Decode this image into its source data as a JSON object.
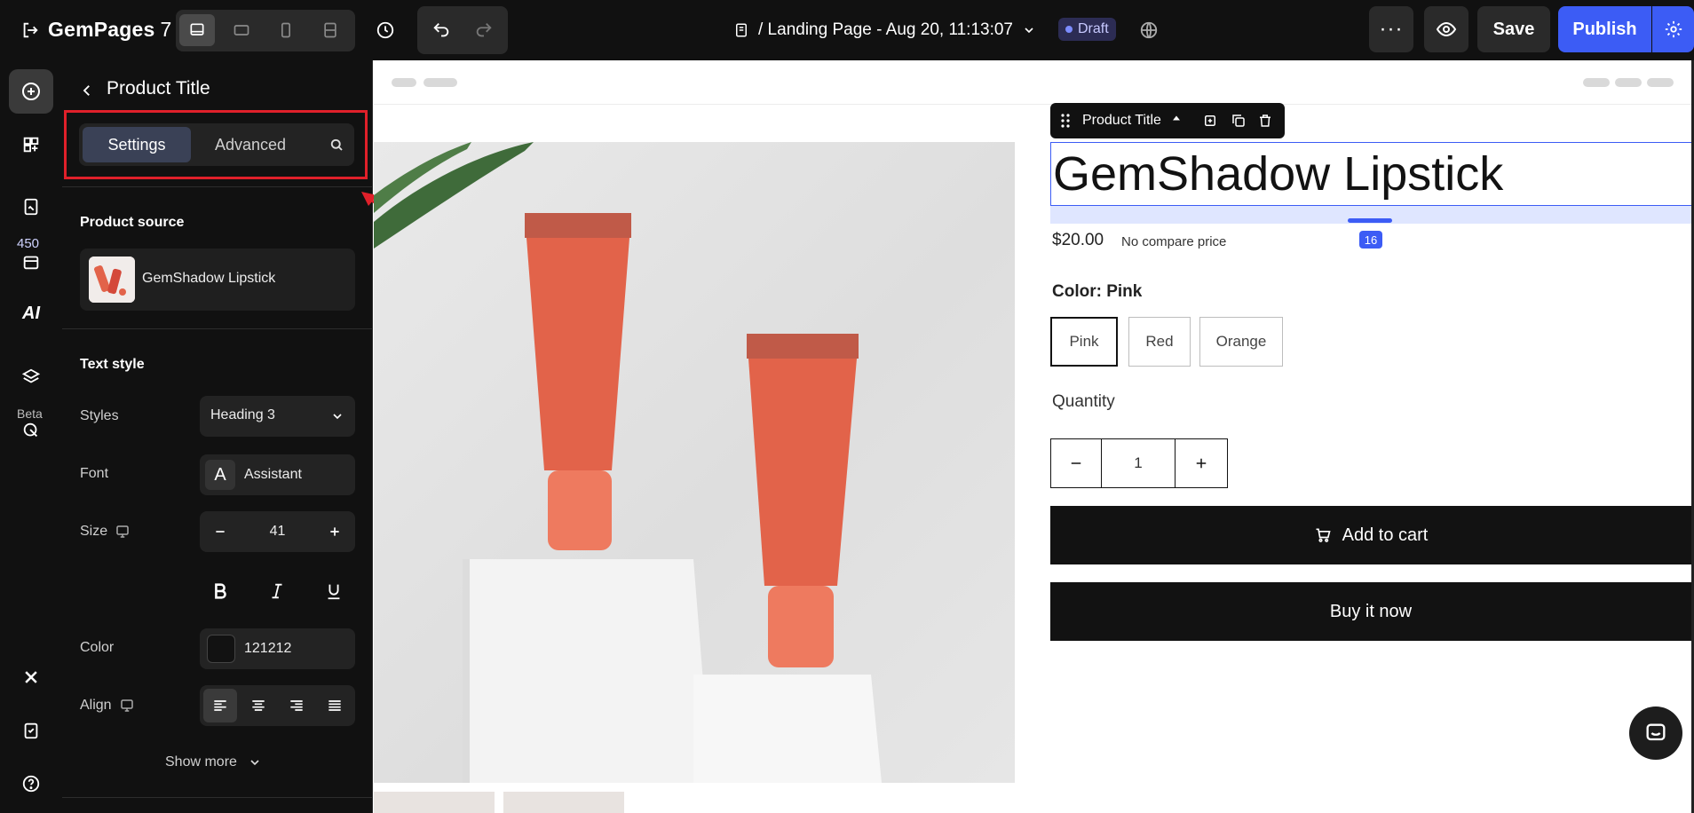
{
  "topbar": {
    "brand": "GemPages",
    "version": "7",
    "page_title": "/ Landing Page - Aug 20, 11:13:07",
    "draft_label": "Draft",
    "more_label": "···",
    "save_label": "Save",
    "publish_label": "Publish"
  },
  "rail": {
    "badge_count": "450",
    "beta_label": "Beta",
    "ai_label": "AI"
  },
  "panel": {
    "title": "Product Title",
    "tabs": {
      "settings": "Settings",
      "advanced": "Advanced"
    },
    "product_source": {
      "label": "Product source",
      "name": "GemShadow Lipstick"
    },
    "text_style": {
      "label": "Text style",
      "styles_label": "Styles",
      "styles_value": "Heading 3",
      "font_label": "Font",
      "font_value": "Assistant",
      "font_glyph": "A",
      "size_label": "Size",
      "size_value": "41",
      "color_label": "Color",
      "color_value": "121212",
      "color_swatch": "#121212",
      "align_label": "Align"
    },
    "show_more": "Show more"
  },
  "canvas": {
    "toolbar_label": "Product Title",
    "product_title": "GemShadow Lipstick",
    "spacing_value": "16",
    "price": "$20.00",
    "compare_price": "No compare price",
    "color_prefix": "Color:",
    "color_selected": "Pink",
    "variants": [
      "Pink",
      "Red",
      "Orange"
    ],
    "quantity_label": "Quantity",
    "quantity_value": "1",
    "add_to_cart": "Add to cart",
    "buy_now": "Buy it now"
  },
  "colors": {
    "accent": "#3c5cf5",
    "dark": "#111111",
    "highlight": "#e0202a",
    "product": "#e2634a"
  }
}
